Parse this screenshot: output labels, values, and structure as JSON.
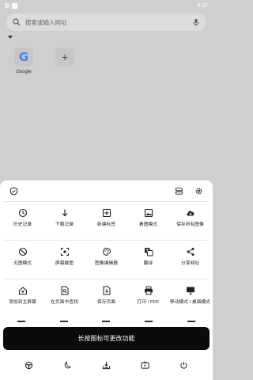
{
  "status_bar": {
    "time": "9:32"
  },
  "search": {
    "placeholder": "搜索或输入网址"
  },
  "shortcuts": [
    {
      "label": "Google",
      "icon": "google-logo-icon"
    },
    {
      "label": "",
      "icon": "plus-icon"
    }
  ],
  "menu": {
    "header_icons": [
      "shield-icon",
      "toggle-layout-icon",
      "gear-icon"
    ],
    "rows": [
      [
        {
          "label": "历史记录",
          "icon": "history-icon"
        },
        {
          "label": "下载记录",
          "icon": "download-icon"
        },
        {
          "label": "新建标签",
          "icon": "new-tab-icon"
        },
        {
          "label": "看图模式",
          "icon": "image-icon"
        },
        {
          "label": "保存所有图像",
          "icon": "cloud-download-icon"
        }
      ],
      [
        {
          "label": "无图模式",
          "icon": "no-image-icon"
        },
        {
          "label": "屏幕截图",
          "icon": "screenshot-icon"
        },
        {
          "label": "图像编辑器",
          "icon": "palette-icon"
        },
        {
          "label": "翻译",
          "icon": "translate-icon"
        },
        {
          "label": "分享网址",
          "icon": "share-icon"
        }
      ],
      [
        {
          "label": "添加到主屏幕",
          "icon": "add-home-icon"
        },
        {
          "label": "在页面中查找",
          "icon": "find-in-page-icon"
        },
        {
          "label": "保存页面",
          "icon": "save-page-icon"
        },
        {
          "label": "打印 / PDF",
          "icon": "print-icon"
        },
        {
          "label": "移动模式 / 桌面模式",
          "icon": "monitor-icon"
        }
      ]
    ]
  },
  "toast": {
    "text": "长按图标可更改功能"
  },
  "bottom_bar": {
    "icons": [
      "steering-wheel-icon",
      "moon-icon",
      "download-tray-icon",
      "tablet-play-icon",
      "power-icon"
    ]
  }
}
